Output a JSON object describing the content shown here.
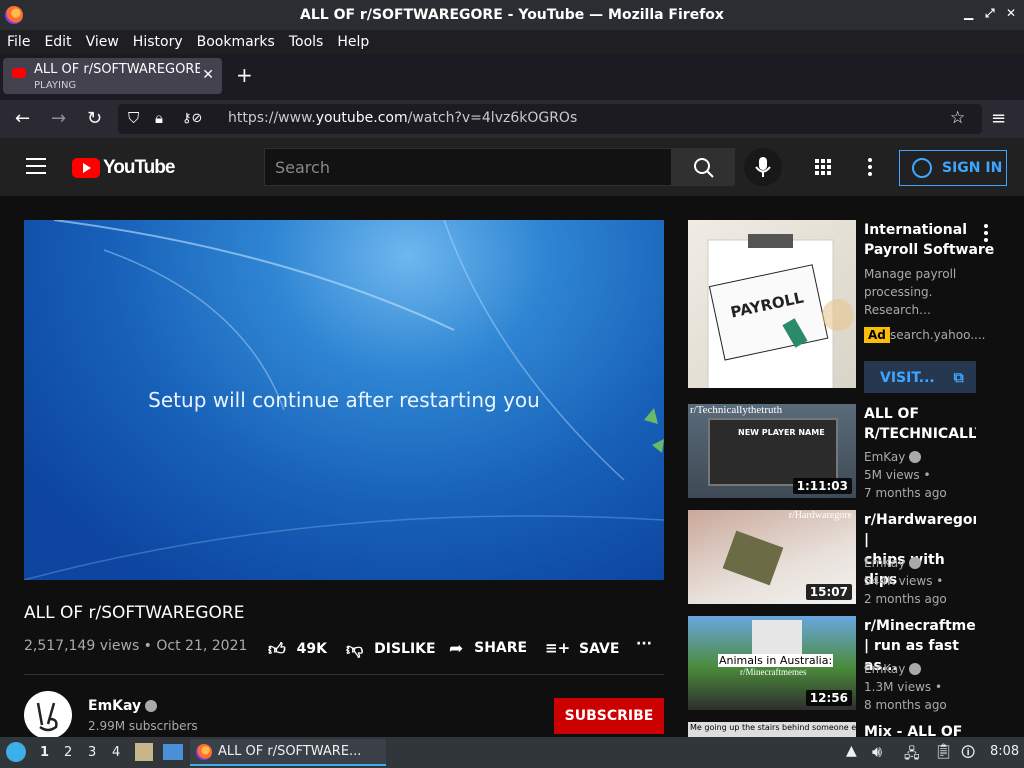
{
  "window": {
    "title": "ALL OF r/SOFTWAREGORE - YouTube — Mozilla Firefox"
  },
  "menu": [
    "File",
    "Edit",
    "View",
    "History",
    "Bookmarks",
    "Tools",
    "Help"
  ],
  "tab": {
    "title": "ALL OF r/SOFTWAREGORE - YouTube",
    "status": "PLAYING"
  },
  "nav": {
    "url_prefix": "https://www.",
    "url_domain": "youtube.com",
    "url_path": "/watch?v=4lvz6kOGROs"
  },
  "yt": {
    "logo_text": "YouTube",
    "search_placeholder": "Search",
    "signin_label": "SIGN IN"
  },
  "video": {
    "screen_text": "Setup will continue after restarting you",
    "title": "ALL OF r/SOFTWAREGORE",
    "meta": "2,517,149 views • Oct 21, 2021",
    "likes": "49K",
    "dislike_label": "DISLIKE",
    "share_label": "SHARE",
    "save_label": "SAVE"
  },
  "channel": {
    "name": "EmKay",
    "subs": "2.99M subscribers",
    "subscribe_label": "SUBSCRIBE"
  },
  "ad": {
    "title_l1": "International",
    "title_l2": "Payroll Software",
    "desc_l1": "Manage payroll",
    "desc_l2": "processing.",
    "desc_l3": "Research…",
    "badge": "Ad",
    "domain": "search.yahoo....",
    "visit_label": "VISIT...",
    "thumb_text": "PAYROLL"
  },
  "related": [
    {
      "title_l1": "ALL OF",
      "title_l2": "R/TECHNICALLYT",
      "channel": "EmKay",
      "views": "5M views •",
      "age": "7 months ago",
      "duration": "1:11:03",
      "thumb_label": "r/Technicallythetruth",
      "thumb_inner": "NEW PLAYER NAME"
    },
    {
      "title_l1": "r/Hardwaregore |",
      "title_l2": "chips with dips",
      "channel": "EmKay",
      "views": "544K views •",
      "age": "2 months ago",
      "duration": "15:07",
      "thumb_label": "r/Hardwaregore"
    },
    {
      "title_l1": "r/Minecraftmemes",
      "title_l2": "| run as fast as...",
      "channel": "EmKay",
      "views": "1.3M views •",
      "age": "8 months ago",
      "duration": "12:56",
      "thumb_label": "Animals in Australia:",
      "thumb_sub": "r/Minecraftmemes"
    },
    {
      "title_l1": "Mix - ALL OF",
      "thumb_label": "Me going up the stairs behind someone else:"
    }
  ],
  "taskbar": {
    "workspaces": [
      "1",
      "2",
      "3",
      "4"
    ],
    "window_label": "ALL OF r/SOFTWARE...",
    "clock": "8:08"
  }
}
